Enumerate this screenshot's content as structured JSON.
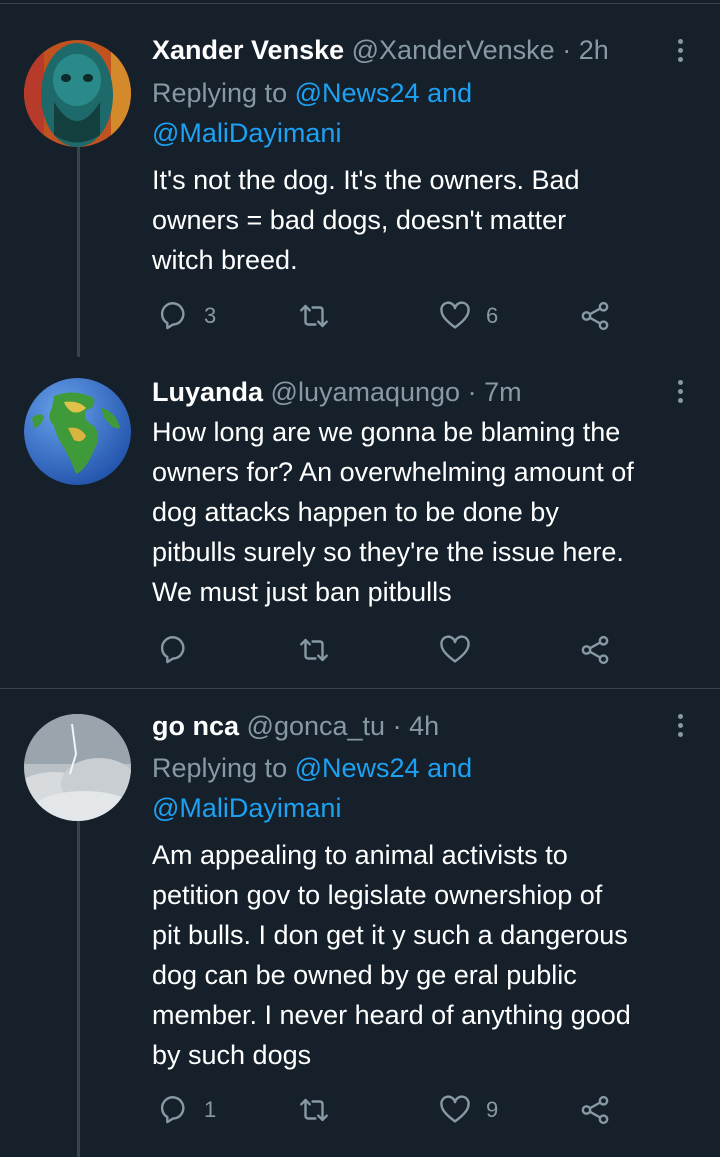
{
  "tweets": [
    {
      "name": "Xander Venske",
      "handle": "@XanderVenske",
      "separator": "·",
      "time": "2h",
      "replying_prefix": "Replying to",
      "replying_line1": "@News24 and",
      "replying_line2": "@MaliDayimani",
      "body": "It's not the dog. It's the owners. Bad\nowners = bad dogs, doesn't matter\nwitch breed.",
      "replies": "3",
      "retweets": "",
      "likes": "6"
    },
    {
      "name": "Luyanda",
      "handle": "@luyamaqungo",
      "separator": "·",
      "time": "7m",
      "body": "How long are we gonna be blaming the\nowners for? An overwhelming amount of\ndog attacks happen to be done by\npitbulls surely so they're the issue here.\nWe must just ban pitbulls",
      "replies": "",
      "retweets": "",
      "likes": ""
    },
    {
      "name": "go nca",
      "handle": "@gonca_tu",
      "separator": "·",
      "time": "4h",
      "replying_prefix": "Replying to",
      "replying_line1": "@News24 and",
      "replying_line2": "@MaliDayimani",
      "body": "Am appealing to animal activists to\npetition gov to legislate ownershiop of\npit bulls. I don get it y such a dangerous\ndog can be owned by ge eral public\nmember. I never heard of anything good\nby such dogs",
      "replies": "1",
      "retweets": "",
      "likes": "9"
    }
  ],
  "colors": {
    "background": "#15202b",
    "secondary_text": "#8899a6",
    "mention": "#1da1f2",
    "divider": "#38444d"
  },
  "icons": [
    "reply-icon",
    "retweet-icon",
    "like-icon",
    "share-icon",
    "more-icon"
  ]
}
